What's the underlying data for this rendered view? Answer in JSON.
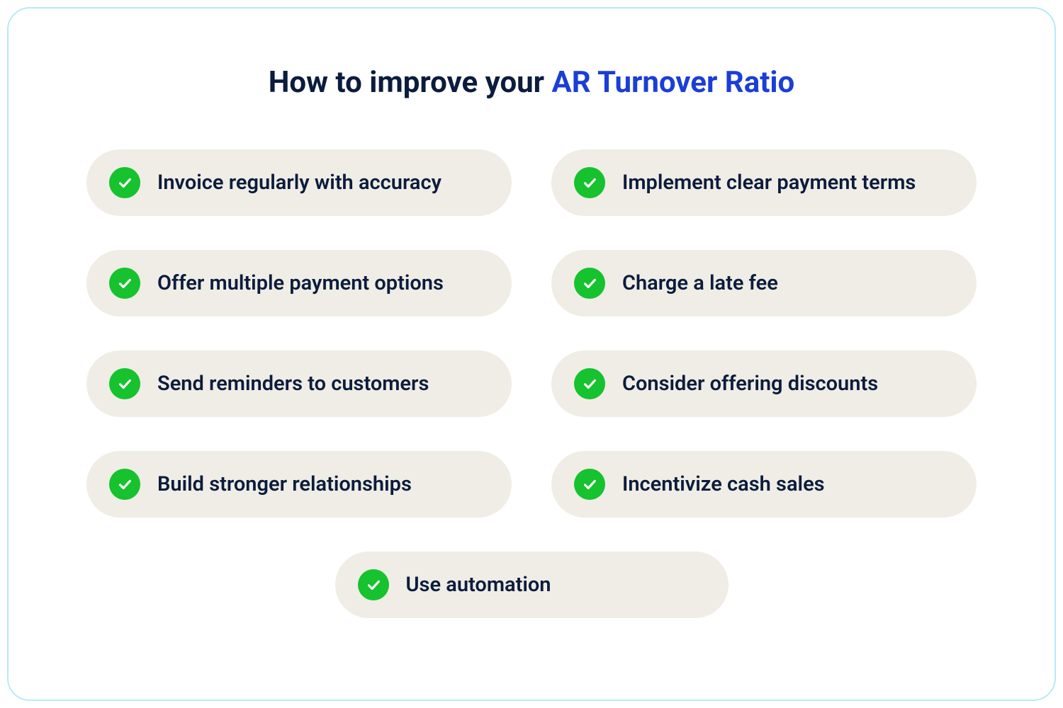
{
  "title_prefix": "How to improve your ",
  "title_accent": "AR Turnover Ratio",
  "colors": {
    "border": "#b7eaf6",
    "title_text": "#0b1c3c",
    "accent": "#1b3ed6",
    "pill_bg": "#efede6",
    "check_bg": "#16c22d",
    "check_mark": "#ffffff"
  },
  "items": [
    "Invoice regularly with accuracy",
    "Implement clear payment terms",
    "Offer multiple payment options",
    "Charge a late fee",
    "Send reminders to customers",
    "Consider offering discounts",
    "Build stronger relationships",
    "Incentivize cash sales",
    "Use automation"
  ]
}
